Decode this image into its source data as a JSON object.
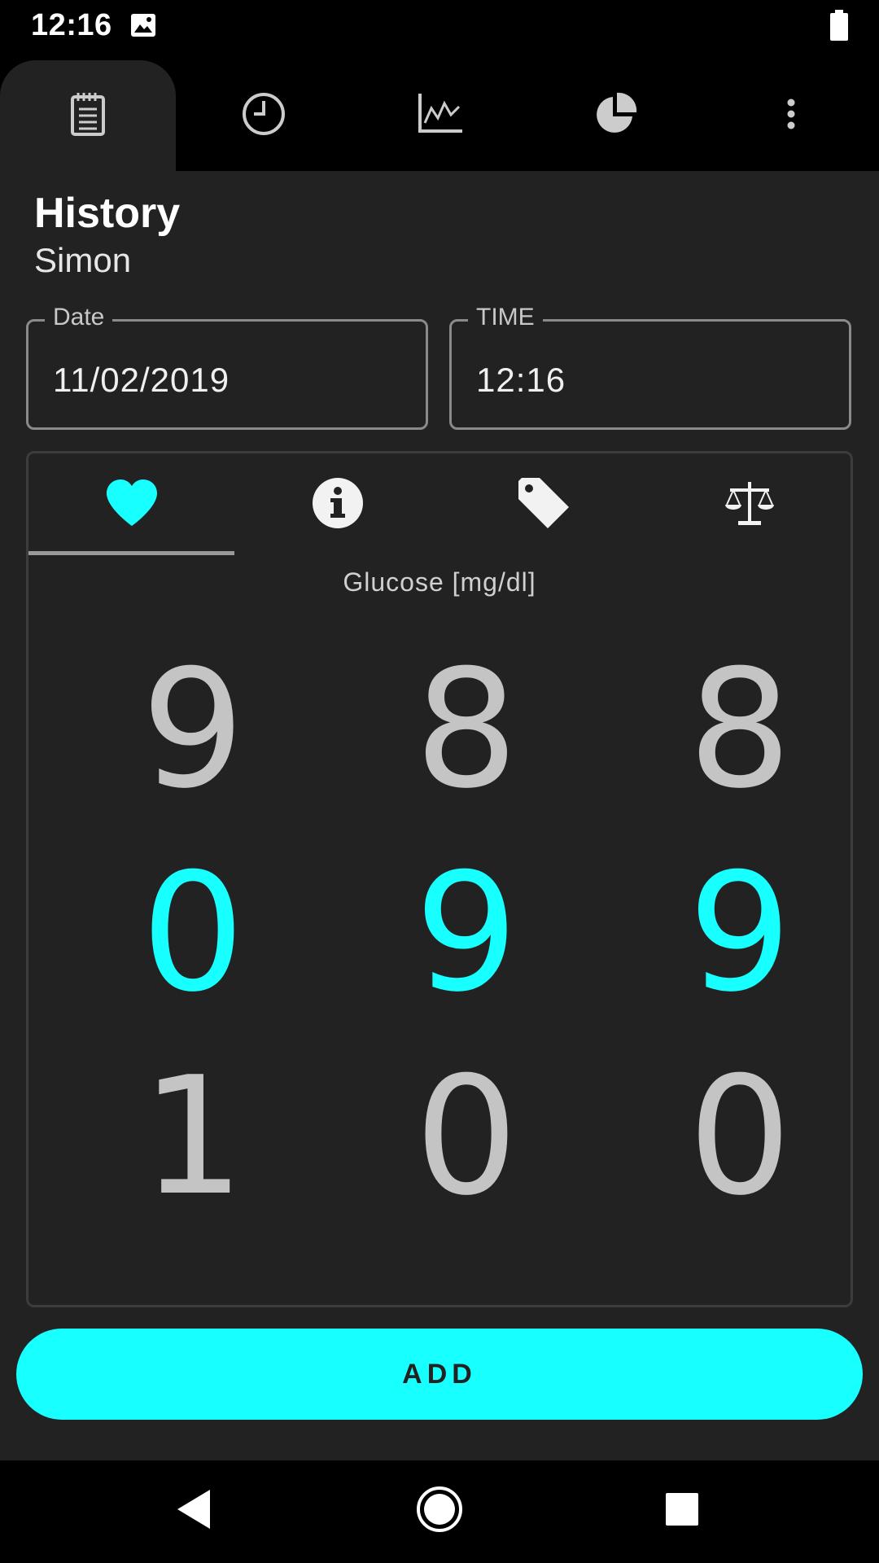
{
  "status_bar": {
    "time": "12:16",
    "icons": [
      "image-icon",
      "battery-icon"
    ]
  },
  "top_tabs": [
    {
      "icon": "notepad-icon",
      "active": true
    },
    {
      "icon": "clock-icon",
      "active": false
    },
    {
      "icon": "line-chart-icon",
      "active": false
    },
    {
      "icon": "pie-chart-icon",
      "active": false
    },
    {
      "icon": "more-vert-icon",
      "active": false
    }
  ],
  "header": {
    "title": "History",
    "subtitle": "Simon"
  },
  "fields": {
    "date": {
      "label": "Date",
      "value": "11/02/2019"
    },
    "time": {
      "label": "TIME",
      "value": "12:16"
    }
  },
  "card": {
    "tabs": [
      {
        "icon": "heart-icon",
        "active": true
      },
      {
        "icon": "info-icon",
        "active": false
      },
      {
        "icon": "tag-icon",
        "active": false
      },
      {
        "icon": "scale-icon",
        "active": false
      }
    ],
    "measure_label": "Glucose [mg/dl]",
    "picker": {
      "columns": [
        {
          "above": "9",
          "selected": "0",
          "below": "1"
        },
        {
          "above": "8",
          "selected": "9",
          "below": "0"
        },
        {
          "above": "8",
          "selected": "9",
          "below": "0"
        }
      ]
    }
  },
  "add_button": {
    "label": "ADD"
  },
  "colors": {
    "accent": "#18ffff",
    "background": "#222222",
    "bar": "#000000"
  }
}
